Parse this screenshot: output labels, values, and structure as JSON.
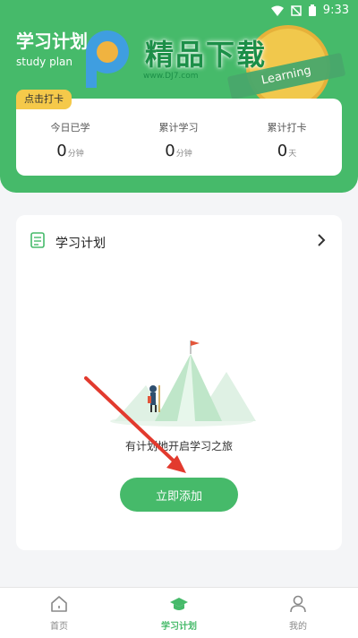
{
  "status_bar": {
    "time": "9:33"
  },
  "header": {
    "title": "学习计划",
    "subtitle": "study plan"
  },
  "watermark": {
    "text": "精品下载",
    "url": "www.DJ7.com",
    "ribbon": "Learning"
  },
  "stats": {
    "badge": "点击打卡",
    "items": [
      {
        "label": "今日已学",
        "value": "0",
        "unit": "分钟"
      },
      {
        "label": "累计学习",
        "value": "0",
        "unit": "分钟"
      },
      {
        "label": "累计打卡",
        "value": "0",
        "unit": "天"
      }
    ]
  },
  "plan": {
    "title": "学习计划",
    "empty_text": "有计划地开启学习之旅",
    "add_label": "立即添加"
  },
  "tabbar": {
    "items": [
      {
        "label": "首页",
        "icon": "home-icon"
      },
      {
        "label": "学习计划",
        "icon": "graduation-cap-icon"
      },
      {
        "label": "我的",
        "icon": "user-icon"
      }
    ],
    "active": "学习计划"
  },
  "colors": {
    "primary": "#46ba6a",
    "badge": "#f5c94a",
    "background": "#f4f5f7"
  }
}
